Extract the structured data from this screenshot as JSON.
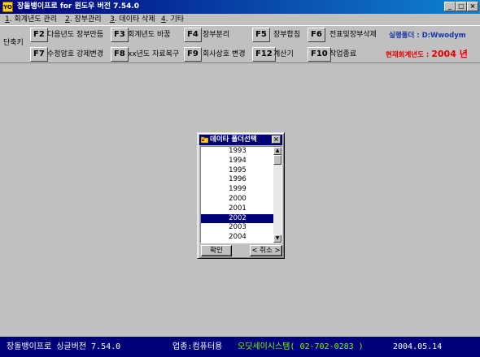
{
  "window": {
    "app_icon": "YO",
    "title": "장돌뱅이프로 for 윈도우 버전 7.54.0",
    "controls": {
      "minimize": "_",
      "maximize": "□",
      "close": "×"
    }
  },
  "menu": [
    {
      "key": "1",
      "label": ". 회계년도 관리"
    },
    {
      "key": "2",
      "label": ". 장부관리"
    },
    {
      "key": "3",
      "label": ". 데이타 삭제"
    },
    {
      "key": "4",
      "label": ". 기타"
    }
  ],
  "toolbar": {
    "shortcut_label": "단축키",
    "row1": [
      {
        "key": "F2",
        "label": "다음년도 장부만듬"
      },
      {
        "key": "F3",
        "label": "회계년도 바꿈"
      },
      {
        "key": "F4",
        "label": "장부분리"
      },
      {
        "key": "F5",
        "label": "장부합침"
      },
      {
        "key": "F6",
        "label": "전표및장부삭제"
      }
    ],
    "row2": [
      {
        "key": "F7",
        "label": "수정암호 강제변경"
      },
      {
        "key": "F8",
        "label": "xx년도 자료복구"
      },
      {
        "key": "F9",
        "label": "회사상호 변경"
      },
      {
        "key": "F12",
        "label": "계산기"
      },
      {
        "key": "F10",
        "label": "작업종료"
      }
    ],
    "run_folder": "실행폴더 : D:Wwodym",
    "current_year_label": "현재회계년도 :",
    "current_year": "2004 년",
    "colors": {
      "run_folder": "#1a36a8",
      "current_year": "#e00000"
    }
  },
  "dialog": {
    "icon": "folder-select-icon",
    "title": "데이타 폴더선택",
    "close": "×",
    "items": [
      "1993",
      "1994",
      "1995",
      "1996",
      "1999",
      "2000",
      "2001",
      "2002",
      "2003",
      "2004"
    ],
    "selected": "2002",
    "scroll_up": "▲",
    "scroll_down": "▼",
    "ok_label": "확인",
    "cancel_label": "< 취소 >"
  },
  "status": {
    "program": "장돌뱅이프로 싱글버전 7.54.0",
    "business": "업종:컴퓨터용",
    "vendor": "오딧세이시스템( 02-702-0283 )",
    "date": "2004.05.14",
    "colors": {
      "bar": "#00007b",
      "text": "#ffffff",
      "vendor": "#7cfc00"
    }
  }
}
